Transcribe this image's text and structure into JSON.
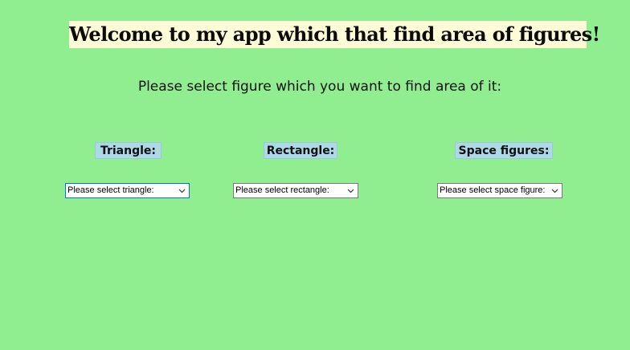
{
  "header": {
    "title": "Welcome to my app which that find area of figures!",
    "subtitle": "Please select figure which you want to find area of it:"
  },
  "sections": [
    {
      "label": "Triangle:",
      "select_value": "Please select triangle:"
    },
    {
      "label": "Rectangle:",
      "select_value": "Please select rectangle:"
    },
    {
      "label": "Space figures:",
      "select_value": "Please select space figure:"
    }
  ],
  "colors": {
    "background": "#90ee90",
    "title_background": "#fffbd6",
    "label_background": "#add8e6",
    "focus_border": "#0078d7"
  },
  "icons": {
    "dropdown": "chevron-down-icon"
  }
}
